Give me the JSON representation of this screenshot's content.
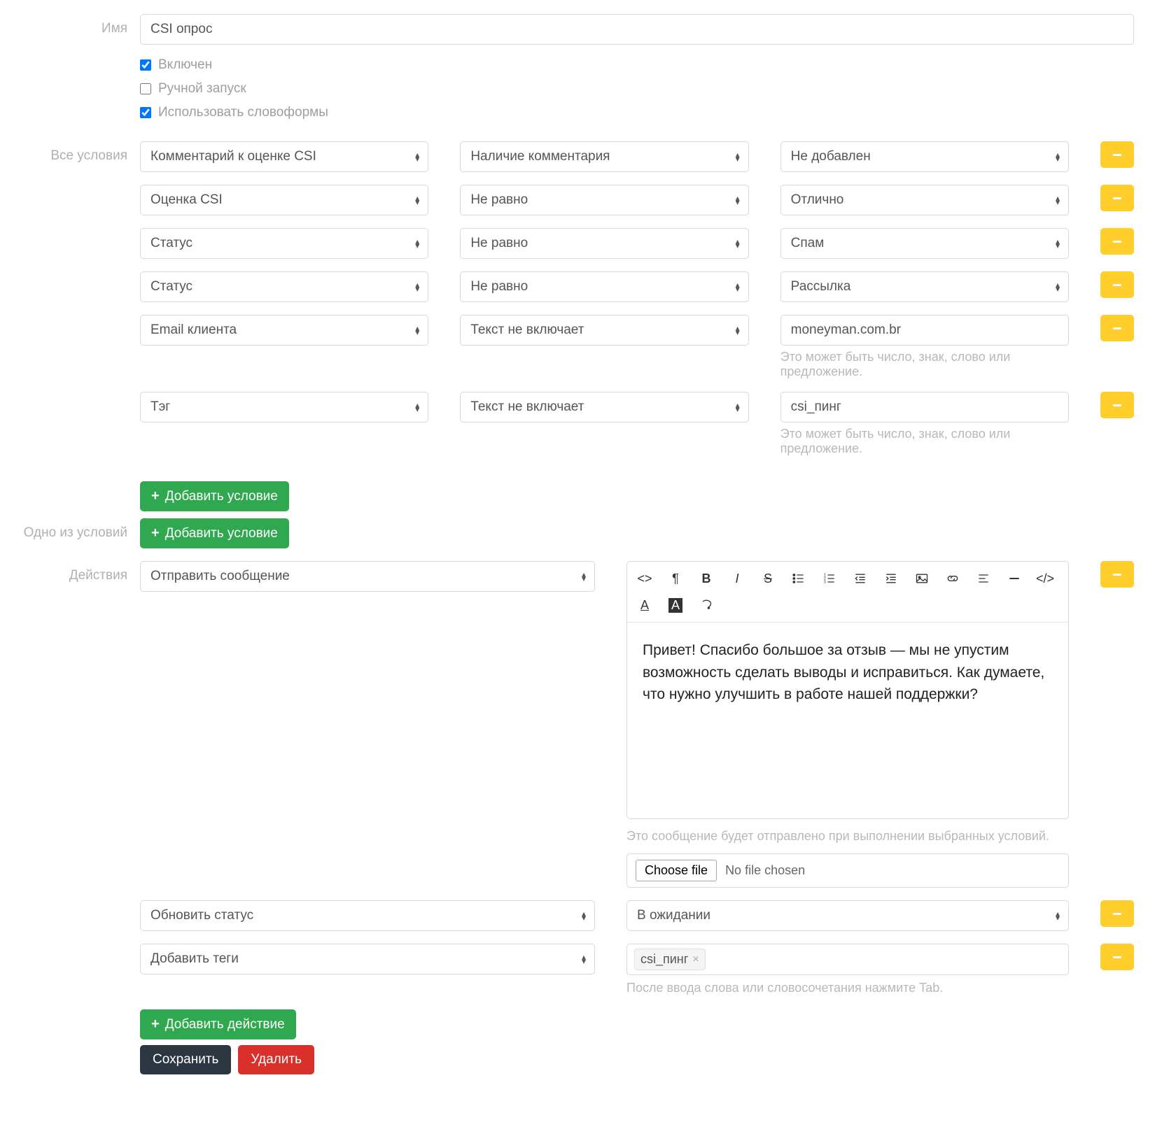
{
  "labels": {
    "name": "Имя",
    "all_conditions": "Все условия",
    "one_of_conditions": "Одно из условий",
    "actions": "Действия"
  },
  "name_value": "CSI опрос",
  "checkboxes": {
    "enabled_label": "Включен",
    "manual_label": "Ручной запуск",
    "wordforms_label": "Использовать словоформы"
  },
  "conditions": [
    {
      "field": "Комментарий к оценке CSI",
      "op": "Наличие комментария",
      "val": "Не добавлен",
      "val_type": "select"
    },
    {
      "field": "Оценка CSI",
      "op": "Не равно",
      "val": "Отлично",
      "val_type": "select"
    },
    {
      "field": "Статус",
      "op": "Не равно",
      "val": "Спам",
      "val_type": "select"
    },
    {
      "field": "Статус",
      "op": "Не равно",
      "val": "Рассылка",
      "val_type": "select"
    },
    {
      "field": "Email клиента",
      "op": "Текст не включает",
      "val": "moneyman.com.br",
      "val_type": "text",
      "help": "Это может быть число, знак, слово или предложение."
    },
    {
      "field": "Тэг",
      "op": "Текст не включает",
      "val": "csi_пинг",
      "val_type": "text",
      "help": "Это может быть число, знак, слово или предложение."
    }
  ],
  "buttons": {
    "add_condition": "Добавить условие",
    "add_action": "Добавить действие",
    "save": "Сохранить",
    "delete": "Удалить"
  },
  "actions": {
    "send_message": {
      "type_label": "Отправить сообщение",
      "body": "Привет! Спасибо большое за отзыв — мы не упустим возможность сделать выводы и исправиться. Как думаете, что нужно улучшить в работе нашей поддержки?",
      "help": "Это сообщение будет отправлено при выполнении выбранных условий.",
      "file_button": "Choose file",
      "file_status": "No file chosen"
    },
    "update_status": {
      "type_label": "Обновить статус",
      "value": "В ожидании"
    },
    "add_tags": {
      "type_label": "Добавить теги",
      "tag": "csi_пинг",
      "help": "После ввода слова или словосочетания нажмите Tab."
    }
  }
}
